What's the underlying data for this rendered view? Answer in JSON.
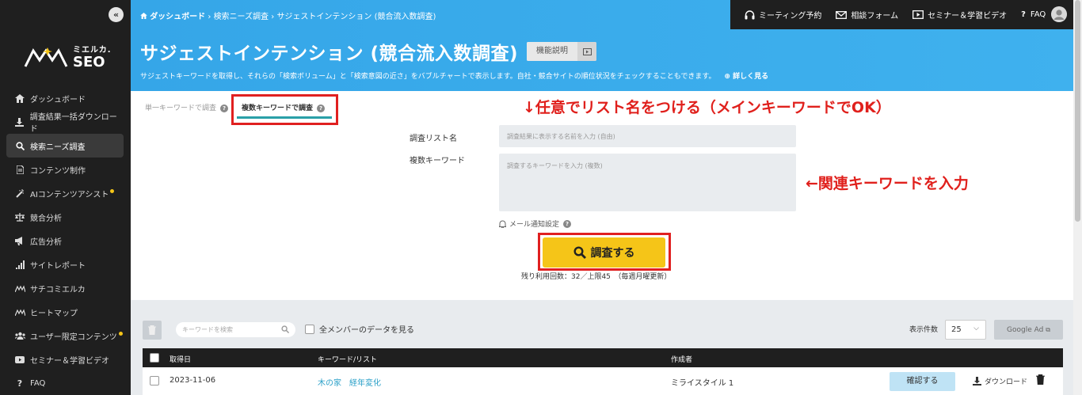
{
  "sidebar": {
    "collapse": "«",
    "logo": {
      "line1": "ミエルカ.",
      "line2": "SEO"
    },
    "items": [
      {
        "label": "ダッシュボード",
        "icon": "home-icon"
      },
      {
        "label": "調査結果一括ダウンロード",
        "icon": "download-icon"
      },
      {
        "label": "検索ニーズ調査",
        "icon": "search-icon",
        "active": true
      },
      {
        "label": "コンテンツ制作",
        "icon": "document-icon"
      },
      {
        "label": "AIコンテンツアシスト",
        "icon": "magic-wand-icon",
        "badge": true
      },
      {
        "label": "競合分析",
        "icon": "scale-icon"
      },
      {
        "label": "広告分析",
        "icon": "megaphone-icon"
      },
      {
        "label": "サイトレポート",
        "icon": "bar-chart-icon"
      },
      {
        "label": "サチコミエルカ",
        "icon": "logo-mini-icon"
      },
      {
        "label": "ヒートマップ",
        "icon": "logo-mini-icon"
      },
      {
        "label": "ユーザー限定コンテンツ",
        "icon": "users-icon",
        "badge": true
      },
      {
        "label": "セミナー＆学習ビデオ",
        "icon": "video-icon"
      },
      {
        "label": "FAQ",
        "icon": "question-icon"
      }
    ]
  },
  "breadcrumb": {
    "home": "ダッシュボード",
    "sep": "›",
    "level1": "検索ニーズ調査",
    "level2": "サジェストインテンション (競合流入数調査)"
  },
  "topbar": {
    "meeting": "ミーティング予約",
    "contact": "相談フォーム",
    "seminar": "セミナー＆学習ビデオ",
    "faq": "FAQ"
  },
  "page": {
    "title": "サジェストインテンション (競合流入数調査)",
    "func_button": "機能説明",
    "subtitle": "サジェストキーワードを取得し、それらの「検索ボリューム」と「検索意図の近さ」をバブルチャートで表示します。自社・競合サイトの順位状況をチェックすることもできます。",
    "more": "詳しく見る"
  },
  "tabs": {
    "single": "単一キーワードで調査",
    "multi": "複数キーワードで調査"
  },
  "annotations": {
    "list_name": "↓任意でリスト名をつける（メインキーワードでOK）",
    "keywords": "←関連キーワードを入力"
  },
  "form": {
    "list_name_label": "調査リスト名",
    "list_name_placeholder": "調査結果に表示する名前を入力 (自由)",
    "keywords_label": "複数キーワード",
    "keywords_placeholder": "調査するキーワードを入力 (複数)",
    "notify": "メール通知設定",
    "submit": "調査する",
    "remaining": "残り利用回数：32／上限45　（毎週月曜更新）"
  },
  "list": {
    "search_placeholder": "キーワードを検索",
    "all_members": "全メンバーのデータを見る",
    "per_page_label": "表示件数",
    "per_page_value": "25",
    "google_ads": "Google Ad",
    "columns": {
      "date": "取得日",
      "keyword": "キーワード/リスト",
      "author": "作成者"
    },
    "rows": [
      {
        "date": "2023-11-06",
        "keyword": "木の家　経年変化",
        "author": "ミライスタイル 1",
        "confirm": "確認する",
        "download": "ダウンロード"
      }
    ]
  },
  "colors": {
    "header": "#35a6e8",
    "sidebar": "#1f1f1f",
    "accent_yellow": "#f5c518",
    "annotation_red": "#e0201c"
  }
}
